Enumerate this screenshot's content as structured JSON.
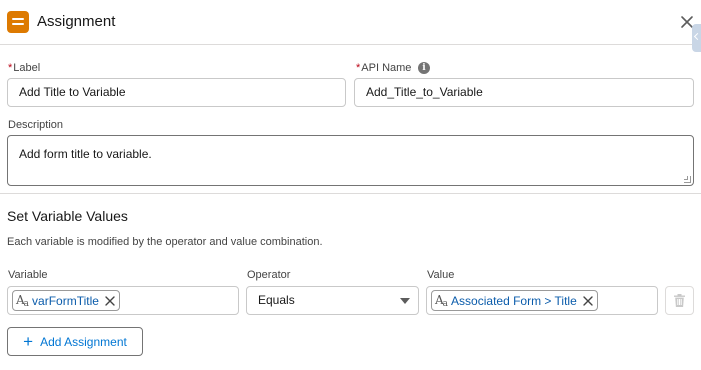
{
  "header": {
    "title": "Assignment",
    "icon": "assignment-icon",
    "accent": "#dd7a01"
  },
  "form": {
    "label": {
      "required": "*",
      "caption": "Label",
      "value": "Add Title to Variable"
    },
    "api_name": {
      "required": "*",
      "caption": "API Name",
      "info": "i",
      "value": "Add_Title_to_Variable"
    },
    "description": {
      "caption": "Description",
      "value": "Add form title to variable."
    }
  },
  "section": {
    "title": "Set Variable Values",
    "description": "Each variable is modified by the operator and value combination."
  },
  "assignment_columns": {
    "variable": "Variable",
    "operator": "Operator",
    "value": "Value"
  },
  "assignment_row": {
    "variable": "varFormTitle",
    "operator": "Equals",
    "value": "Associated Form > Title",
    "type_icon": "text-type-icon"
  },
  "add_button": {
    "label": "Add Assignment"
  },
  "colors": {
    "link": "#0b5cab",
    "brand": "#0176d3",
    "required": "#ba0517"
  }
}
